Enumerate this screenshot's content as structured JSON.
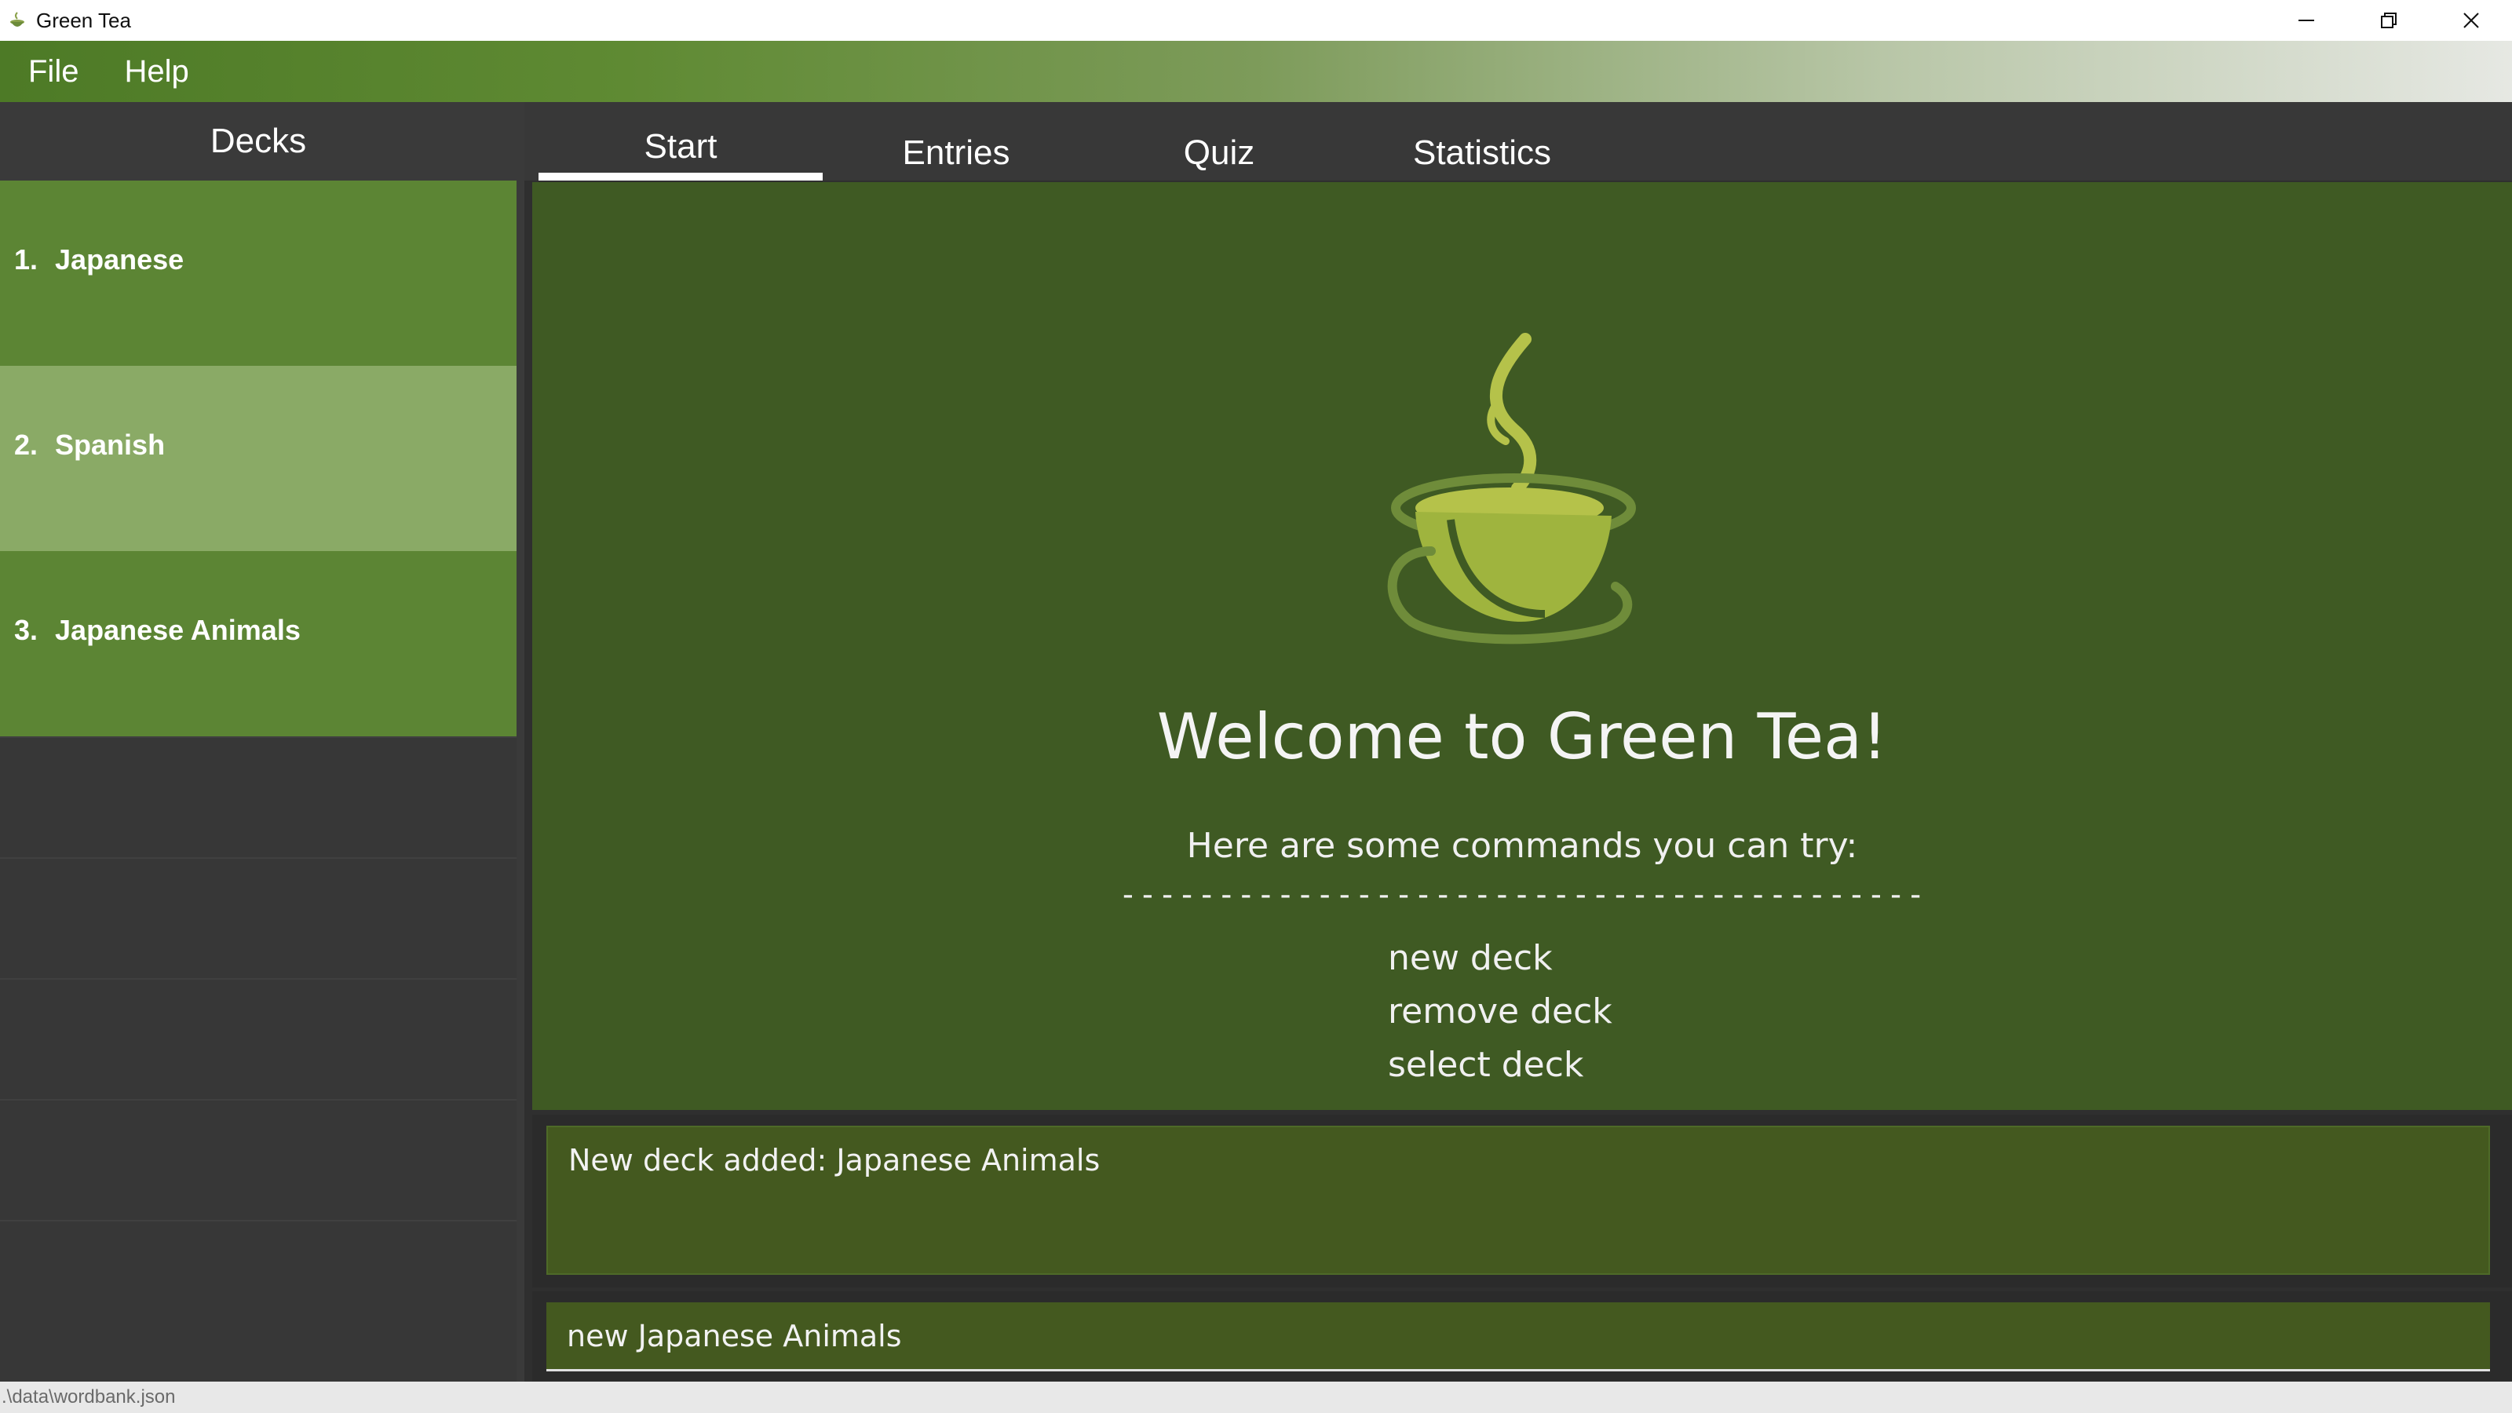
{
  "window": {
    "title": "Green Tea",
    "icon": "tea-cup-icon"
  },
  "menu": {
    "items": [
      "File",
      "Help"
    ]
  },
  "sidebar": {
    "header": "Decks",
    "decks": [
      {
        "index": "1.",
        "name": "Japanese"
      },
      {
        "index": "2.",
        "name": "Spanish"
      },
      {
        "index": "3.",
        "name": "Japanese Animals"
      }
    ]
  },
  "tabs": [
    "Start",
    "Entries",
    "Quiz",
    "Statistics"
  ],
  "start": {
    "welcome": "Welcome to Green Tea!",
    "intro": "Here are some commands you can try:",
    "divider": "-----------------------------------------",
    "commands": [
      "new deck",
      "remove deck",
      "select deck"
    ]
  },
  "result": {
    "text": "New deck added: Japanese Animals"
  },
  "command": {
    "value": "new Japanese Animals"
  },
  "status": {
    "path": ".\\data\\wordbank.json"
  },
  "colors": {
    "accent": "#3f5a23",
    "deck": "#5c8534",
    "deck_selected": "#8aaa66"
  }
}
